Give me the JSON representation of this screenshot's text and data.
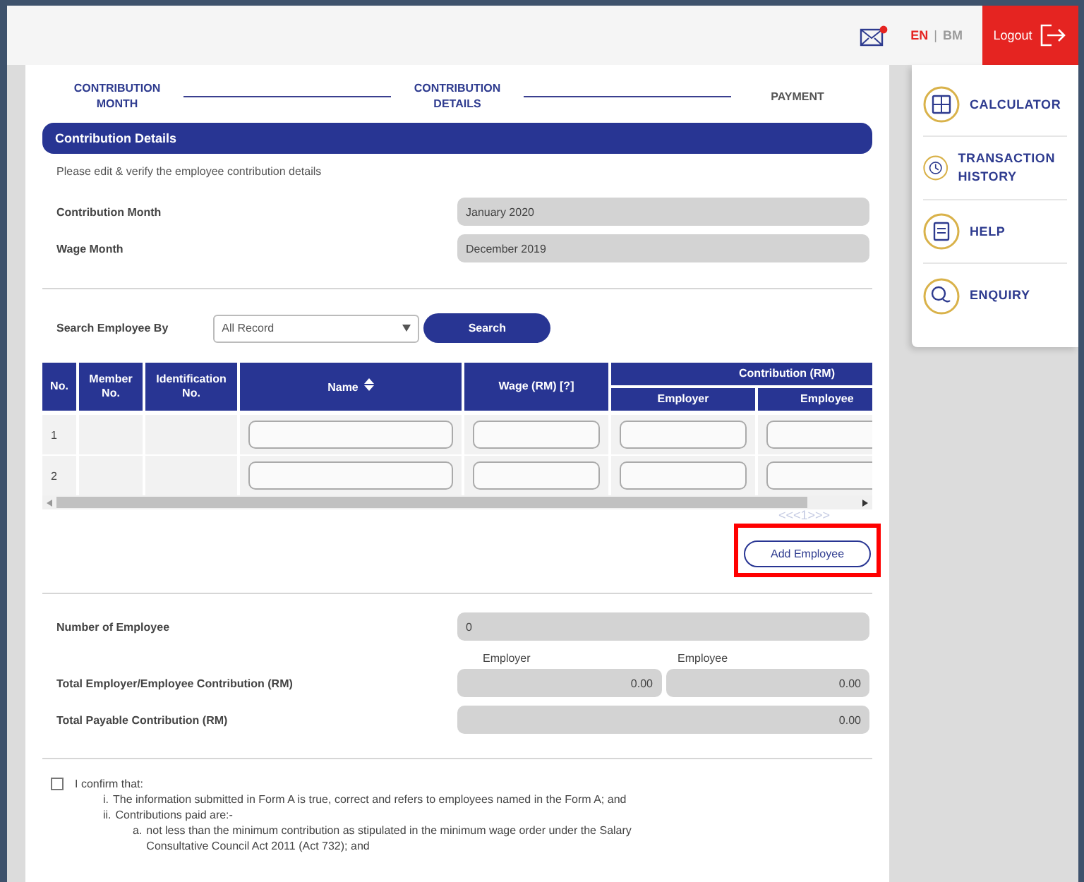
{
  "top_bar": {
    "mail_unread": true,
    "languages": [
      {
        "label": "EN",
        "selected": true
      },
      {
        "label": "BM",
        "selected": false
      }
    ],
    "language_separator": "|",
    "logout": "Logout"
  },
  "steps": [
    {
      "label": "CONTRIBUTION MONTH",
      "done": true
    },
    {
      "label": "CONTRIBUTION DETAILS",
      "done": true
    },
    {
      "label": "PAYMENT",
      "done": false
    }
  ],
  "section_title": "Contribution Details",
  "instruction": "Please edit & verify the employee contribution details",
  "month_fields": [
    {
      "label": "Contribution Month",
      "value": "January 2020"
    },
    {
      "label": "Wage Month",
      "value": "December 2019"
    }
  ],
  "search": {
    "label": "Search Employee By",
    "select_value": "All Record",
    "button": "Search"
  },
  "table": {
    "columns": [
      {
        "label": "No.",
        "sortable": false
      },
      {
        "label": "Member No.",
        "sortable": false
      },
      {
        "label": "Identification No.",
        "sortable": false
      },
      {
        "label": "Name",
        "sortable": true
      },
      {
        "label": "Wage (RM) [?]",
        "sortable": false
      }
    ],
    "group_header": "Contribution (RM)",
    "group_columns": [
      "Employer",
      "Employee"
    ],
    "rows": [
      {
        "no": "1"
      },
      {
        "no": "2"
      }
    ]
  },
  "pagination": "<<<1>>>",
  "add_employee": {
    "label": "Add Employee",
    "highlighted": true
  },
  "summary": {
    "count_label": "Number of Employee",
    "count_value": "0",
    "sub_headers": [
      "Employer",
      "Employee"
    ],
    "total_label": "Total Employer/Employee Contribution (RM)",
    "total_values": [
      "0.00",
      "0.00"
    ],
    "payable_label": "Total Payable Contribution (RM)",
    "payable_value": "0.00"
  },
  "confirm": {
    "checked": false,
    "lead": "I confirm that:",
    "items": [
      {
        "marker": "i.",
        "text": "The information submitted in Form A is true, correct and refers to employees named in the Form A; and"
      },
      {
        "marker": "ii.",
        "text": "Contributions paid are:-",
        "children": [
          {
            "marker": "a.",
            "text": "not less than the minimum contribution as stipulated in the minimum wage order under the Salary Consultative Council Act 2011 (Act 732); and"
          }
        ]
      }
    ]
  },
  "side_menu": [
    {
      "kind": "calculator",
      "label": "CALCULATOR"
    },
    {
      "kind": "history",
      "label": "TRANSACTION HISTORY"
    },
    {
      "kind": "help",
      "label": "HELP"
    },
    {
      "kind": "enquiry",
      "label": "ENQUIRY"
    }
  ]
}
